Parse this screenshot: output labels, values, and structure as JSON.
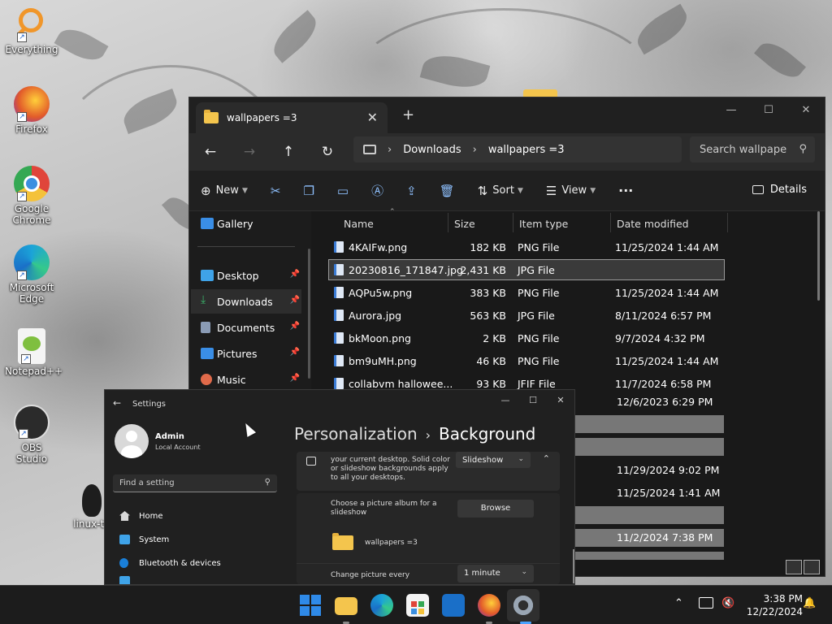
{
  "desktop_icons": [
    {
      "label": "Everything",
      "color": "#f0962a"
    },
    {
      "label": "Firefox",
      "color": "#e25b2a"
    },
    {
      "label": "Google Chrome",
      "color": "#3b8fe0"
    },
    {
      "label": "Microsoft Edge",
      "color": "#1ba3d8"
    },
    {
      "label": "Notepad++",
      "color": "#7fbf3f"
    },
    {
      "label": "OBS Studio",
      "color": "#2b2b2b"
    },
    {
      "label": "linux-tu",
      "color": "#1d1d1d"
    }
  ],
  "explorer": {
    "tab_title": "wallpapers =3",
    "new_tab": "+",
    "address": {
      "segments": [
        "Downloads",
        "wallpapers =3"
      ],
      "sep": "›"
    },
    "search_placeholder": "Search wallpape",
    "toolbar": {
      "new_label": "New",
      "sort_label": "Sort",
      "view_label": "View",
      "more_label": "···",
      "details_label": "Details"
    },
    "nav": [
      {
        "label": "Gallery",
        "color": "#3a8ee6"
      },
      {
        "label": "Desktop",
        "color": "#3fa3e8"
      },
      {
        "label": "Downloads",
        "color": "#3ab36a"
      },
      {
        "label": "Documents",
        "color": "#8a9bb5"
      },
      {
        "label": "Pictures",
        "color": "#3a8ee6"
      },
      {
        "label": "Music",
        "color": "#e06a4a"
      }
    ],
    "columns": {
      "name": "Name",
      "size": "Size",
      "type": "Item type",
      "date": "Date modified"
    },
    "files": [
      {
        "name": "4KAIFw.png",
        "size": "182 KB",
        "type": "PNG File",
        "date": "11/25/2024 1:44 AM"
      },
      {
        "name": "20230816_171847.jpg",
        "size": "2,431 KB",
        "type": "JPG File",
        "date": ""
      },
      {
        "name": "AQPu5w.png",
        "size": "383 KB",
        "type": "PNG File",
        "date": "11/25/2024 1:44 AM"
      },
      {
        "name": "Aurora.jpg",
        "size": "563 KB",
        "type": "JPG File",
        "date": "8/11/2024 6:57 PM"
      },
      {
        "name": "bkMoon.png",
        "size": "2 KB",
        "type": "PNG File",
        "date": "9/7/2024 4:32 PM"
      },
      {
        "name": "bm9uMH.png",
        "size": "46 KB",
        "type": "PNG File",
        "date": "11/25/2024 1:44 AM"
      },
      {
        "name": "collabvm hallowee...",
        "size": "93 KB",
        "type": "JFIF File",
        "date": "11/7/2024 6:58 PM"
      }
    ],
    "extra_dates": [
      "12/6/2023 6:29 PM",
      "11/29/2024 9:02 PM",
      "11/25/2024 1:41 AM",
      "11/2/2024 7:38 PM"
    ]
  },
  "settings": {
    "title": "Settings",
    "user_name": "Admin",
    "user_type": "Local Account",
    "search_placeholder": "Find a setting",
    "nav": [
      {
        "label": "Home",
        "color": "#d8d8d8"
      },
      {
        "label": "System",
        "color": "#3fa3e8"
      },
      {
        "label": "Bluetooth & devices",
        "color": "#1a7fd8"
      }
    ],
    "breadcrumb_parent": "Personalization",
    "breadcrumb_current": "Background",
    "bg_desc": "your current desktop. Solid color or slideshow backgrounds apply to all your desktops.",
    "bg_dropdown": "Slideshow",
    "album_label": "Choose a picture album for a slideshow",
    "browse_label": "Browse",
    "album_folder": "wallpapers =3",
    "change_label": "Change picture every",
    "change_value": "1 minute"
  },
  "taskbar": {
    "time": "3:38 PM",
    "date": "12/22/2024",
    "apps": [
      {
        "name": "start",
        "color": "#2f8ae8"
      },
      {
        "name": "file-explorer",
        "color": "#f4c54d"
      },
      {
        "name": "edge",
        "color": "#1ba3d8"
      },
      {
        "name": "store",
        "color": "#3a7bd5"
      },
      {
        "name": "outlook",
        "color": "#1a6fc8"
      },
      {
        "name": "firefox",
        "color": "#e25b2a"
      },
      {
        "name": "settings",
        "color": "#8a8a8a"
      }
    ]
  }
}
